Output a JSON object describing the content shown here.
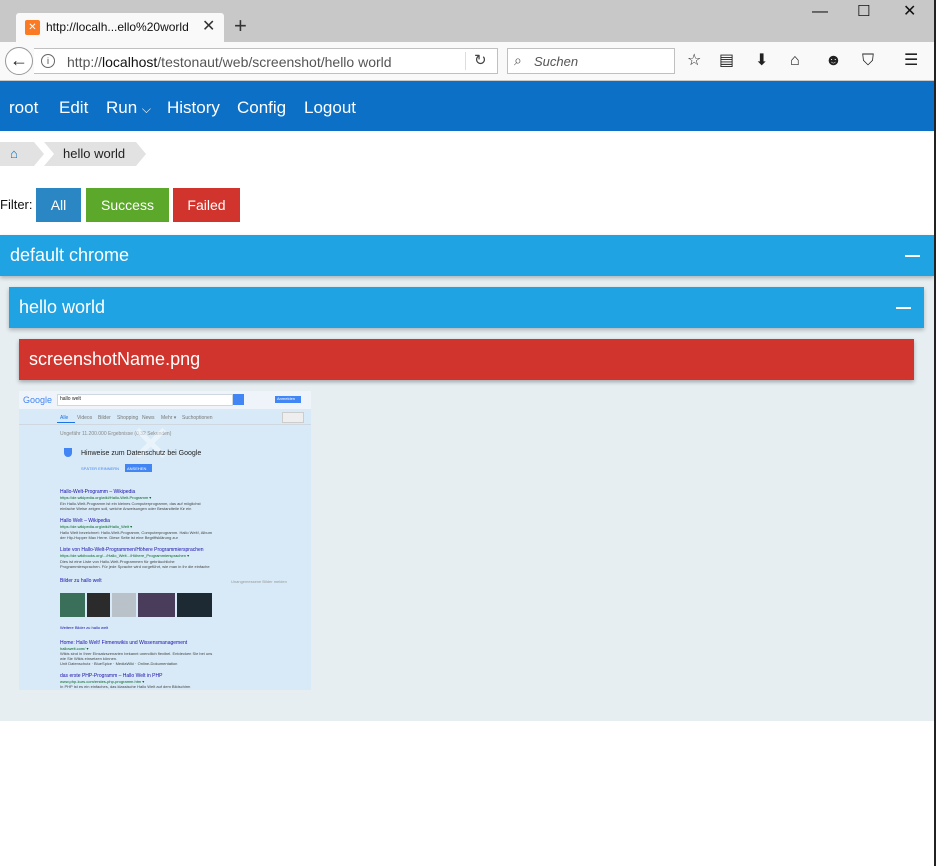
{
  "browser": {
    "tab_title": "http://localh...ello%20world",
    "tab_close": "✕",
    "new_tab": "+",
    "window_controls": {
      "minimize": "—",
      "maximize": "☐",
      "close": "✕"
    },
    "url_prefix": "http://",
    "url_host": "localhost",
    "url_path": "/testonaut/web/screenshot/hello world",
    "search_placeholder": "Suchen"
  },
  "nav": {
    "items": [
      "root",
      "Edit",
      "Run",
      "History",
      "Config",
      "Logout"
    ],
    "run_caret": "⌵"
  },
  "breadcrumb": {
    "current": "hello world"
  },
  "filter": {
    "label": "Filter:",
    "buttons": [
      {
        "label": "All",
        "color": "#2a87c4"
      },
      {
        "label": "Success",
        "color": "#5ba82b"
      },
      {
        "label": "Failed",
        "color": "#d0342c"
      }
    ]
  },
  "panels": {
    "outer_title": "default chrome",
    "inner_title": "hello world",
    "screenshot_title": "screenshotName.png"
  },
  "colors": {
    "nav_bg": "#0b70c6",
    "panel_bg": "#1fa3e2",
    "failed": "#d0342c",
    "content_bg": "#e6eef2"
  },
  "thumbnail": {
    "logo": "Google",
    "query": "hallo welt",
    "sign_in": "Anmelden",
    "tabs": [
      "Alle",
      "Videos",
      "Bilder",
      "Shopping",
      "News",
      "Mehr ▾",
      "Suchoptionen"
    ],
    "result_count": "Ungefähr 11.200.000 Ergebnisse (0,32 Sekunden)",
    "privacy_title": "Hinweise zum Datenschutz bei Google",
    "privacy_later": "SPÄTER ERINNERN",
    "privacy_view": "ANSEHEN",
    "results": [
      {
        "title": "Hallo-Welt-Programm – Wikipedia",
        "url": "https://de.wikipedia.org/wiki/Hallo-Welt-Programm ▾",
        "snippet": "Ein Hallo-Welt-Programm ist ein kleines Computerprogramm, das auf möglichst einfache Weise zeigen soll, welche Anweisungen oder Bestandteile für ein"
      },
      {
        "title": "Hallo Welt – Wikipedia",
        "url": "https://de.wikipedia.org/wiki/Hallo_Welt ▾",
        "snippet": "Hallo Welt bezeichnet: Hallo-Welt-Programm, Computerprogramm. Hallo Welt!, Album der Hip-Hopper Max Herre. Diese Seite ist eine Begriffsklärung zur"
      },
      {
        "title": "Liste von Hallo-Welt-Programmen/Höhere Programmiersprachen",
        "url": "https://de.wikibooks.org/.../Hallo_Welt.../Höhere_Programmiersprachen ▾",
        "snippet": "Dies ist eine Liste von Hallo-Welt-Programmen für gebräuchliche Programmiersprachen. Für jede Sprache wird vorgeführt, wie man in ihr die einfache Aufgabe"
      }
    ],
    "images_title": "Bilder zu hallo welt",
    "images_report": "Unangemessene Bilder melden",
    "more_images": "Weitere Bilder zu hallo welt",
    "results2": [
      {
        "title": "Home: Hallo Welt! Firmenwikis und Wissensmanagement",
        "url": "hallowelt.com/ ▾",
        "snippet": "Wikis sind in Ihrer Einsatzszenarien bekannt unendlich flexibel. Entdecken Sie bei uns wie Sie Wikis einsetzen können.",
        "links": "Unit Datenschutz · BlueSpice · MediaWiki · Online-Dokumentation"
      },
      {
        "title": "das erste PHP-Programm – Hallo Welt in PHP",
        "url": "www.php-kurs.com/erstes-php-programm.htm ▾",
        "snippet": "In PHP ist es ein einfaches, das klassische Hallo Welt auf dem Bildschirm"
      }
    ]
  }
}
